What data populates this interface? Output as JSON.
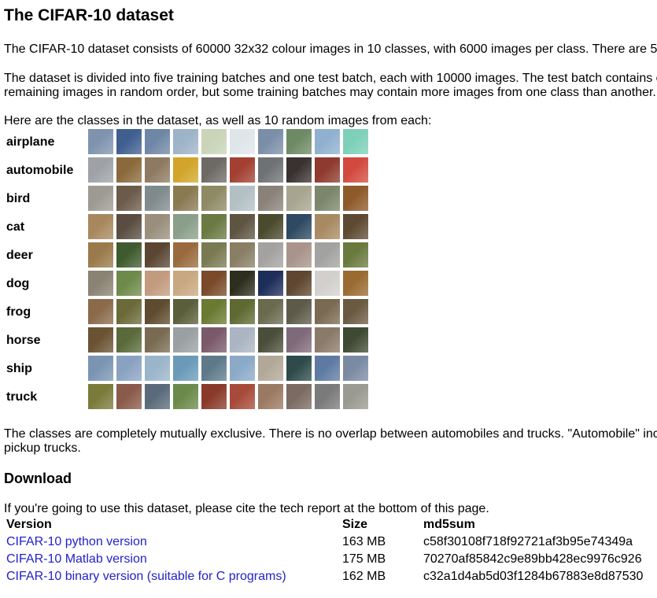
{
  "title": "The CIFAR-10 dataset",
  "intro": "The CIFAR-10 dataset consists of 60000 32x32 colour images in 10 classes, with 6000 images per class. There are 5",
  "batches_line1": "The dataset is divided into five training batches and one test batch, each with 10000 images. The test batch contains e",
  "batches_line2": "remaining images in random order, but some training batches may contain more images from one class than another.",
  "classes_intro": "Here are the classes in the dataset, as well as 10 random images from each:",
  "classes": [
    {
      "label": "airplane",
      "colors": [
        "#7f93ae",
        "#3f5f8f",
        "#6f87a6",
        "#9db3c8",
        "#c9d4b8",
        "#dfe6ea",
        "#7b8ea8",
        "#6e8a64",
        "#8fb0cf",
        "#7ed0b8"
      ]
    },
    {
      "label": "automobile",
      "colors": [
        "#9ea2a6",
        "#8a6a3c",
        "#8e7a62",
        "#d2a52a",
        "#6d6a66",
        "#a34032",
        "#6f7274",
        "#3a3230",
        "#8e3a2e",
        "#d24a3e"
      ]
    },
    {
      "label": "bird",
      "colors": [
        "#9c9a92",
        "#6c5a4a",
        "#7f8a8c",
        "#8a7a52",
        "#8e8a64",
        "#b2c0c4",
        "#8a8278",
        "#a7a58e",
        "#7c866a",
        "#8e5a2a"
      ]
    },
    {
      "label": "cat",
      "colors": [
        "#a8875e",
        "#5a4c40",
        "#9a8e7c",
        "#8a9e8a",
        "#6a7a42",
        "#5e5442",
        "#4a4a2e",
        "#2e4a62",
        "#a88a62",
        "#5e4a32"
      ]
    },
    {
      "label": "deer",
      "colors": [
        "#9a7a4a",
        "#3e5a2e",
        "#5a4632",
        "#9a6a3e",
        "#7a7a52",
        "#8a7e64",
        "#a4a2a0",
        "#a8948a",
        "#a2a2a0",
        "#6a7a3e"
      ]
    },
    {
      "label": "dog",
      "colors": [
        "#8a8272",
        "#6e8a4a",
        "#c29a7e",
        "#c8a880",
        "#7a4a2a",
        "#2e2e1e",
        "#1e2e5a",
        "#5e4630",
        "#d2d0cc",
        "#9a6a32"
      ]
    },
    {
      "label": "frog",
      "colors": [
        "#8a6a4a",
        "#6a6a3a",
        "#5e4a2e",
        "#5a5e3a",
        "#6a7a32",
        "#5e6a32",
        "#6a6a4e",
        "#5e5a4a",
        "#7a6a52",
        "#6a5a42"
      ]
    },
    {
      "label": "horse",
      "colors": [
        "#6a5232",
        "#5a6a3a",
        "#7a6a52",
        "#9aa0a2",
        "#7a5a6a",
        "#aab4c2",
        "#4a4e3a",
        "#7e6a7a",
        "#8a7a6a",
        "#3e4a32"
      ]
    },
    {
      "label": "ship",
      "colors": [
        "#7a94b2",
        "#8aa2c2",
        "#9ab4ca",
        "#6a9ab8",
        "#5e7a8a",
        "#8aaac8",
        "#b2a898",
        "#2e4a4a",
        "#5e7aa2",
        "#7a8aa2"
      ]
    },
    {
      "label": "truck",
      "colors": [
        "#7a7a3a",
        "#8a5a4a",
        "#5a6a7a",
        "#6a8a4a",
        "#8a3a2a",
        "#a84a3a",
        "#9a7a62",
        "#7a6a62",
        "#7a7a7a",
        "#9a9a92"
      ]
    }
  ],
  "exclusive_line1": "The classes are completely mutually exclusive. There is no overlap between automobiles and trucks. \"Automobile\" inc",
  "exclusive_line2": "pickup trucks.",
  "download": {
    "title": "Download",
    "cite": "If you're going to use this dataset, please cite the tech report at the bottom of this page.",
    "headers": {
      "version": "Version",
      "size": "Size",
      "md5": "md5sum"
    },
    "link_color": "#2222cc",
    "rows": [
      {
        "version": "CIFAR-10 python version",
        "size": "163 MB",
        "md5": "c58f30108f718f92721af3b95e74349a"
      },
      {
        "version": "CIFAR-10 Matlab version",
        "size": "175 MB",
        "md5": "70270af85842c9e89bb428ec9976c926"
      },
      {
        "version": "CIFAR-10 binary version (suitable for C programs)",
        "size": "162 MB",
        "md5": "c32a1d4ab5d03f1284b67883e8d87530"
      }
    ]
  }
}
